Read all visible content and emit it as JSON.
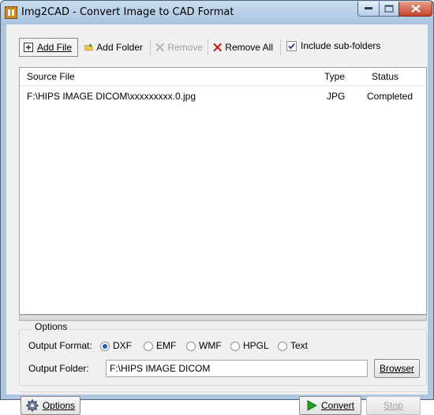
{
  "window": {
    "title": "Img2CAD - Convert Image to CAD Format"
  },
  "toolbar": {
    "add_file": "Add File",
    "add_folder": "Add Folder",
    "remove": "Remove",
    "remove_all": "Remove All",
    "include_subfolders": "Include sub-folders",
    "include_subfolders_checked": true
  },
  "filelist": {
    "columns": [
      "Source File",
      "Type",
      "Status"
    ],
    "rows": [
      {
        "source": "F:\\HIPS IMAGE DICOM\\xxxxxxxxx.0.jpg",
        "type": "JPG",
        "status": "Completed"
      }
    ]
  },
  "options": {
    "group_label": "Options",
    "output_format_label": "Output Format:",
    "formats": [
      "DXF",
      "EMF",
      "WMF",
      "HPGL",
      "Text"
    ],
    "selected_format": "DXF",
    "output_folder_label": "Output Folder:",
    "output_folder_value": "F:\\HIPS IMAGE DICOM",
    "browser_button": "Browser"
  },
  "footer": {
    "options_button": "Options",
    "convert_button": "Convert",
    "stop_button": "Stop"
  },
  "colors": {
    "accent": "#1c5fb4",
    "close_button": "#c4432a"
  }
}
